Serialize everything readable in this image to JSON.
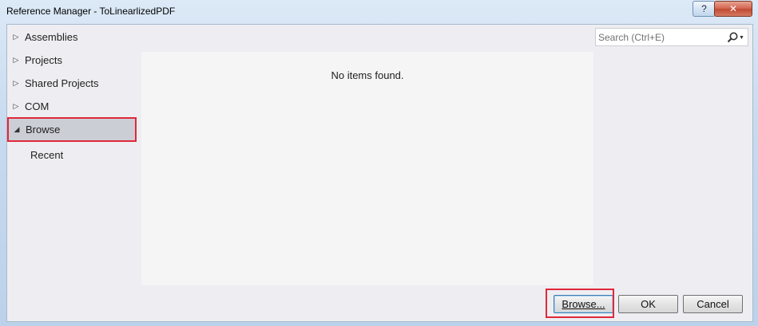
{
  "window": {
    "title": "Reference Manager - ToLinearlizedPDF",
    "help_label": "?",
    "close_label": "✕"
  },
  "sidebar": {
    "items": [
      {
        "label": "Assemblies",
        "expanded": false
      },
      {
        "label": "Projects",
        "expanded": false
      },
      {
        "label": "Shared Projects",
        "expanded": false
      },
      {
        "label": "COM",
        "expanded": false
      },
      {
        "label": "Browse",
        "expanded": true,
        "selected": true
      }
    ],
    "sub_items": [
      {
        "label": "Recent"
      }
    ],
    "collapsed_glyph": "▷",
    "expanded_glyph": "◢"
  },
  "search": {
    "placeholder": "Search (Ctrl+E)",
    "value": ""
  },
  "content": {
    "empty_message": "No items found."
  },
  "buttons": {
    "browse": "Browse...",
    "ok": "OK",
    "cancel": "Cancel"
  },
  "colors": {
    "highlight": "#e0283a",
    "selected_bg": "#ccced6",
    "content_bg": "#f5f5f5"
  }
}
